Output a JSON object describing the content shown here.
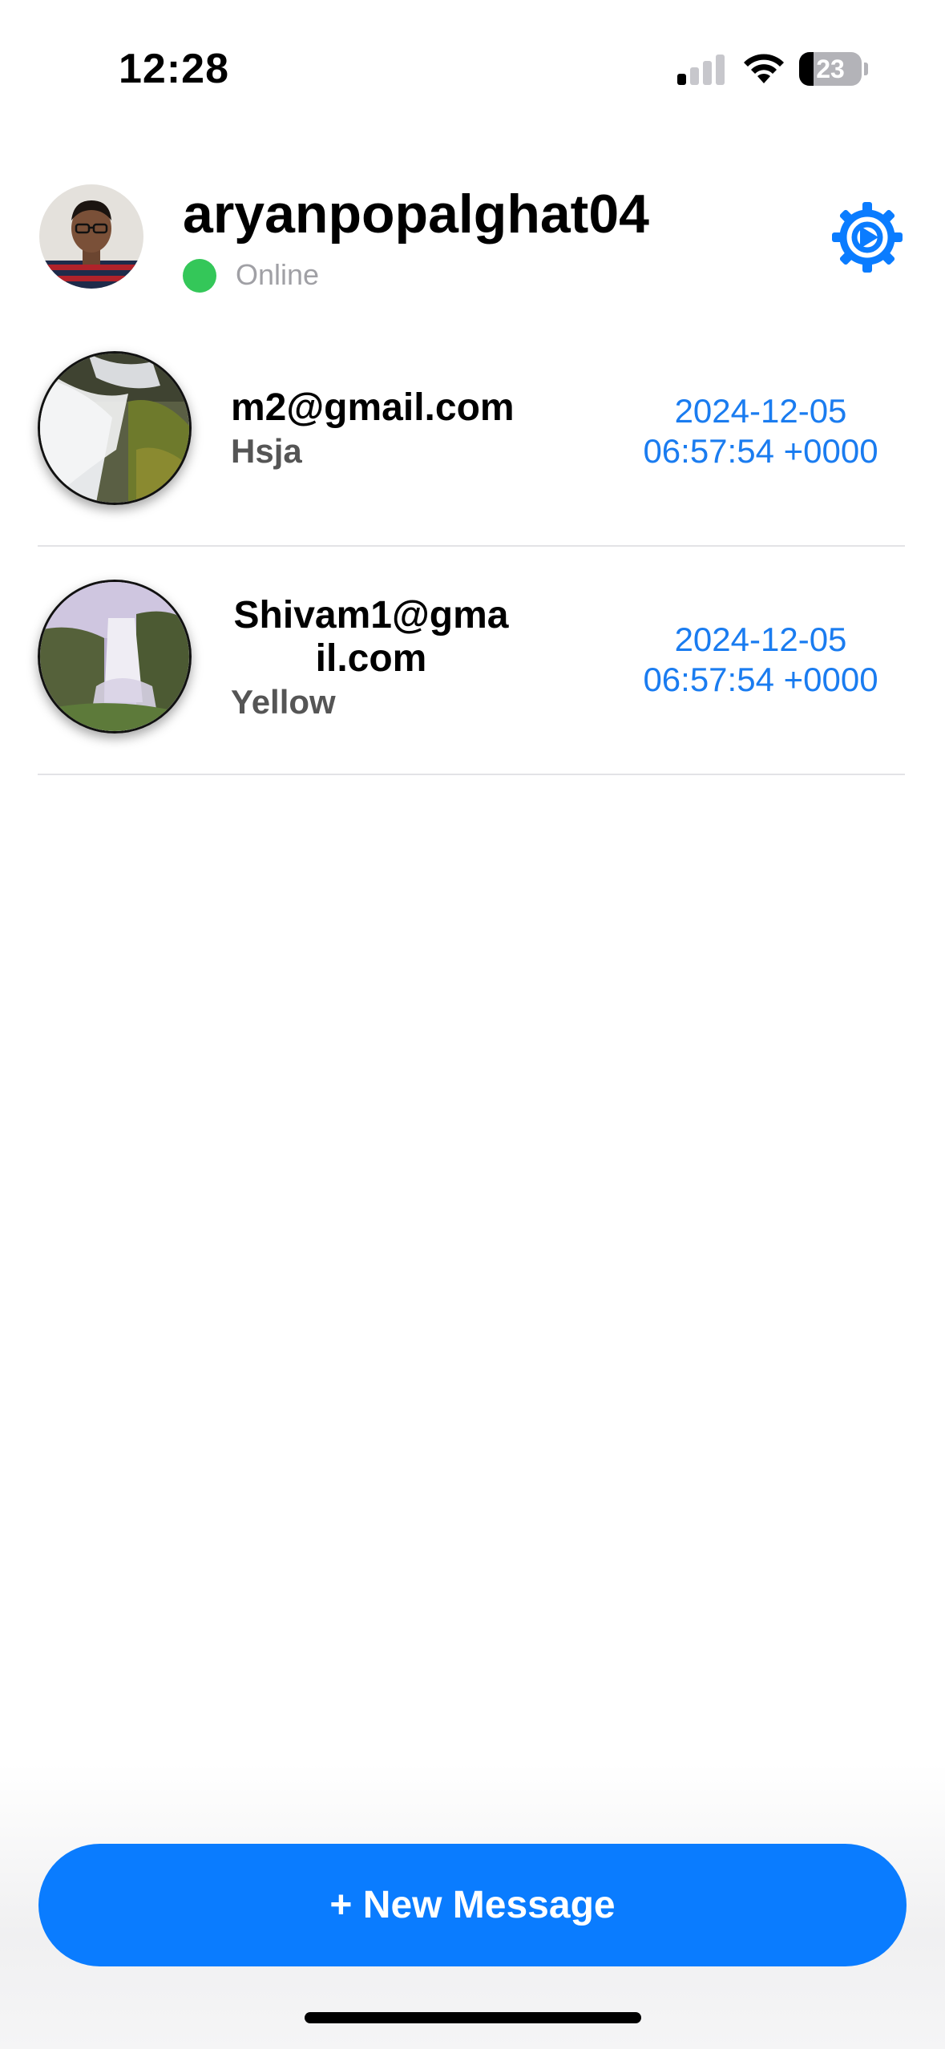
{
  "status_bar": {
    "time": "12:28",
    "battery": "23",
    "battery_level": 0.23,
    "signal_bars_active": 1,
    "signal_bars_total": 4
  },
  "header": {
    "username": "aryanpopalghat04",
    "status": "Online",
    "status_color": "#34c759",
    "settings_icon": "gear-icon"
  },
  "conversations": [
    {
      "name": "m2@gmail.com",
      "preview": "Hsja",
      "date": "2024-12-05",
      "time": "06:57:54 +0000"
    },
    {
      "name": "Shivam1@gmail.com",
      "preview": "Yellow",
      "date": "2024-12-05",
      "time": "06:57:54 +0000"
    }
  ],
  "new_message_label": "+ New Message",
  "colors": {
    "accent": "#0a7cff",
    "timestamp": "#1a7cf0",
    "online": "#34c759"
  }
}
